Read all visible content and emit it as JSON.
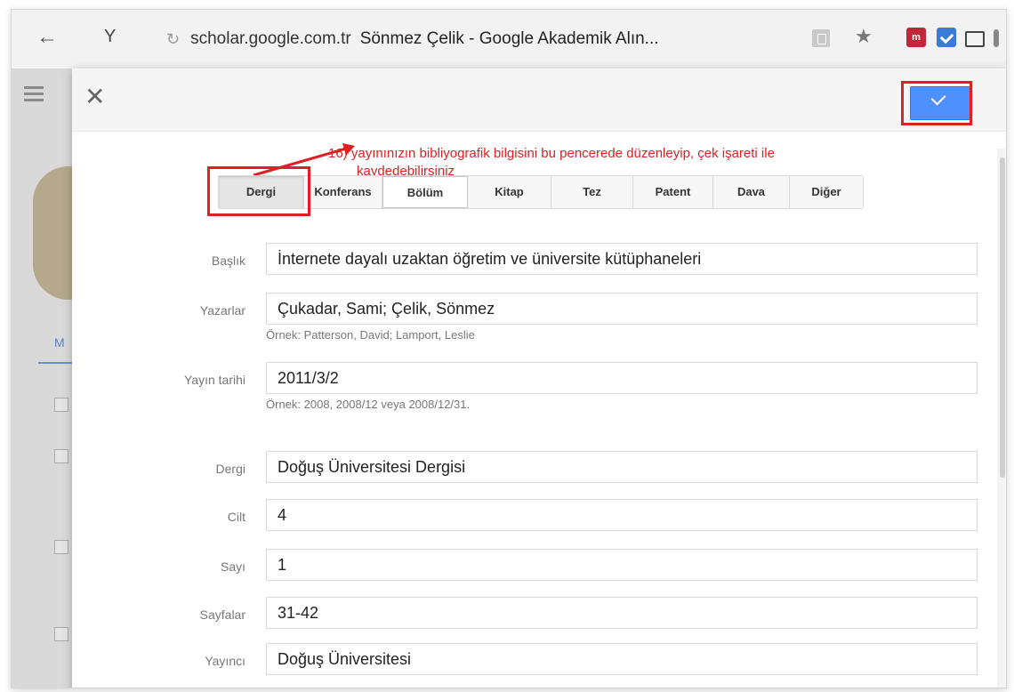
{
  "browser": {
    "back_symbol": "←",
    "y_symbol": "Y",
    "reload_symbol": "↻",
    "url_domain": "scholar.google.com.tr",
    "page_title": "Sönmez Çelik - Google Akademik Alın...",
    "star_symbol": "★",
    "ext1_label": "m"
  },
  "dialog": {
    "close_symbol": "✕",
    "annotation_line1": "16) yayınınızın bibliyografik bilgisini bu pencerede düzenleyip, çek işareti ile",
    "annotation_line2": "kaydedebilirsiniz",
    "type_tabs": [
      "Dergi",
      "Konferans",
      "Bölüm",
      "Kitap",
      "Tez",
      "Patent",
      "Dava",
      "Diğer"
    ],
    "selected_tab": "Dergi"
  },
  "form": {
    "title_label": "Başlık",
    "title_value": "İnternete dayalı uzaktan öğretim ve üniversite kütüphaneleri",
    "authors_label": "Yazarlar",
    "authors_value": "Çukadar, Sami; Çelik, Sönmez",
    "authors_hint": "Örnek: Patterson, David; Lamport, Leslie",
    "date_label": "Yayın tarihi",
    "date_value": "2011/3/2",
    "date_hint": "Örnek: 2008, 2008/12 veya 2008/12/31.",
    "journal_label": "Dergi",
    "journal_value": "Doğuş Üniversitesi Dergisi",
    "volume_label": "Cilt",
    "volume_value": "4",
    "issue_label": "Sayı",
    "issue_value": "1",
    "pages_label": "Sayfalar",
    "pages_value": "31-42",
    "publisher_label": "Yayıncı",
    "publisher_value": "Doğuş Üniversitesi"
  },
  "background": {
    "m_letter": "M"
  },
  "colors": {
    "save_button": "#4d90fe",
    "highlight": "#e02020",
    "annotation_text": "#e02020"
  }
}
